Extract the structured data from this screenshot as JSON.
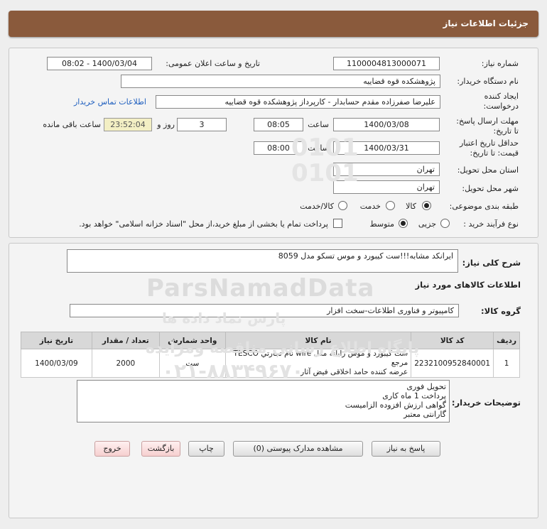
{
  "header": {
    "title": "جزئیات اطلاعات نیاز"
  },
  "form": {
    "need_number_label": "شماره نیاز:",
    "need_number": "1100004813000071",
    "announce_label": "تاریخ و ساعت اعلان عمومی:",
    "announce_value": "1400/03/04 - 08:02",
    "buyer_org_label": "نام دستگاه خریدار:",
    "buyer_org": "پژوهشکده قوه قضاییه",
    "creator_label_line1": "ایجاد کننده",
    "creator_label_line2": "درخواست:",
    "creator": "علیرضا  صفرزاده مقدم  حسابدار - کارپرداز پژوهشکده قوه قضاییه",
    "contact_link": "اطلاعات تماس خریدار",
    "reply_deadline_label_line1": "مهلت ارسال پاسخ:",
    "reply_deadline_label_line2": "تا تاریخ:",
    "reply_date": "1400/03/08",
    "time_label": "ساعت",
    "reply_time": "08:05",
    "days_value": "3",
    "days_label": "روز و",
    "remaining_time": "23:52:04",
    "remaining_label": "ساعت باقی مانده",
    "price_validity_label_line1": "حداقل تاریخ اعتبار",
    "price_validity_label_line2": "قیمت: تا تاریخ:",
    "validity_date": "1400/03/31",
    "validity_time": "08:00",
    "province_label": "استان محل تحویل:",
    "province": "تهران",
    "city_label": "شهر محل تحویل:",
    "city": "تهران",
    "category_label": "طبقه بندی موضوعی:",
    "category_options": [
      "کالا",
      "خدمت",
      "کالا/خدمت"
    ],
    "category_selected": "کالا",
    "process_label": "نوع فرآیند خرید :",
    "process_options": [
      "جزیی",
      "متوسط"
    ],
    "process_selected": "متوسط",
    "treasury_note": "پرداخت تمام یا بخشی از مبلغ خرید،از محل \"اسناد خزانه اسلامی\" خواهد بود."
  },
  "summary": {
    "label": "شرح کلی نیاز:",
    "text": "ایرانکد مشابه!!!ست کیبورد و موس تسکو مدل 8059"
  },
  "goods": {
    "section_title": "اطلاعات کالاهای مورد نیاز",
    "group_label": "گروه کالا:",
    "group_value": "کامپیوتر و فناوری اطلاعات-سخت افزار",
    "columns": [
      "ردیف",
      "کد کالا",
      "نام کالا",
      "واحد شمارش",
      "تعداد / مقدار",
      "تاریخ نیاز"
    ],
    "rows": [
      {
        "index": "1",
        "code": "2232100952840001",
        "name_line1": "ست کیبورد و موس رایانه مدل wire نام تجارتي TESCO مرجع",
        "name_line2": "عرضه کننده حامد اخلاقی فیض آثار",
        "unit": "ست",
        "qty": "2000",
        "date": "1400/03/09"
      }
    ]
  },
  "notes": {
    "label": "توضیحات خریدار:",
    "lines": [
      "تحویل فوری",
      "پرداخت 1 ماه کاری",
      "گواهی ارزش افزوده الزامیست",
      "گارانتی معتبر"
    ]
  },
  "buttons": {
    "reply": "پاسخ به نیاز",
    "view_docs": "مشاهده مدارک پیوستی (0)",
    "print": "چاپ",
    "back": "بازگشت",
    "exit": "خروج"
  },
  "watermark": {
    "brand": "ParsNamadData",
    "fa_line1": "پارس نماد داده ها",
    "fa_line2": "پایگاه اطلاع رسانی مناقصه ومزایده",
    "phone": "۰۲۱-۸۸۳۴۹۶۷۰",
    "digits": "0101"
  },
  "colors": {
    "header_bg": "#8a5a3c",
    "timer_bg": "#f3efc4",
    "link": "#1f5fbf",
    "pink_button": "#f6cfcf"
  }
}
